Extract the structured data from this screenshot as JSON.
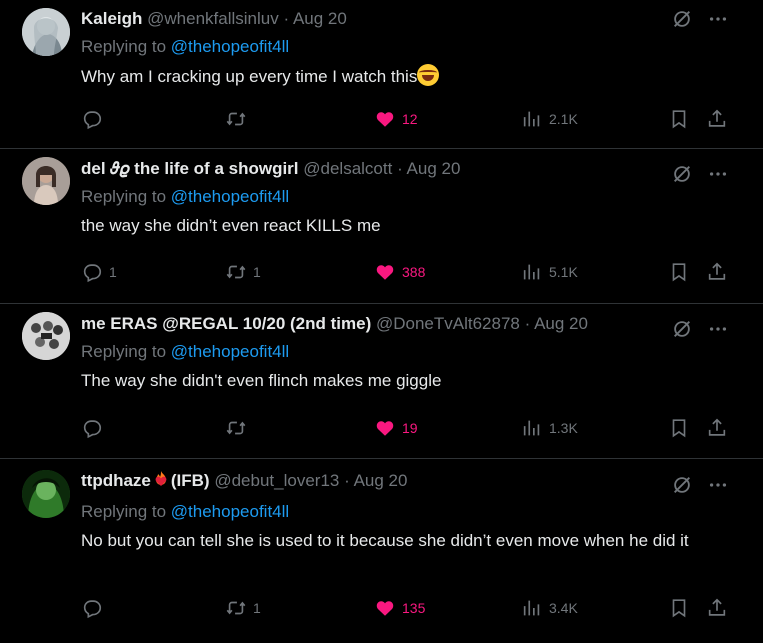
{
  "tweets": [
    {
      "name": "Kaleigh",
      "name_suffix": "",
      "handle": "@whenkfallsinluv",
      "dot": "·",
      "date": "Aug 20",
      "replying_label": "Replying to",
      "replying_to": "@thehopeofit4ll",
      "text": "Why am I cracking up every time I watch this",
      "text_emoji": "tears-of-joy-emoji",
      "replies": "",
      "retweets": "",
      "likes": "12",
      "views": "2.1K",
      "avatar_color": "#b9c2c7"
    },
    {
      "name": "del 𝜗𝜚 the life of a showgirl",
      "name_suffix": "",
      "handle": "@delsalcott",
      "dot": "·",
      "date": "Aug 20",
      "replying_label": "Replying to",
      "replying_to": "@thehopeofit4ll",
      "text": "the way she didn’t even react KILLS me",
      "text_emoji": "",
      "replies": "1",
      "retweets": "1",
      "likes": "388",
      "views": "5.1K",
      "avatar_color": "#8d7d72"
    },
    {
      "name": "me ERAS @REGAL 10/20 (2nd time)",
      "name_suffix": "",
      "handle": "@DoneTvAlt62878",
      "dot": "·",
      "date": "Aug 20",
      "replying_label": "Replying to",
      "replying_to": "@thehopeofit4ll",
      "text": "The way she didn't even flinch makes me giggle",
      "text_emoji": "",
      "replies": "",
      "retweets": "",
      "likes": "19",
      "views": "1.3K",
      "avatar_color": "#cfcfcf"
    },
    {
      "name": "ttpdhaze",
      "name_suffix": "(IFB)",
      "name_emoji": "heart-on-fire-emoji",
      "handle": "@debut_lover13",
      "dot": "·",
      "date": "Aug 20",
      "replying_label": "Replying to",
      "replying_to": "@thehopeofit4ll",
      "text": "No but you can tell she is used to it because she didn’t even move when he did it",
      "text_emoji": "",
      "replies": "",
      "retweets": "1",
      "likes": "135",
      "views": "3.4K",
      "avatar_color": "#1f5a1c"
    }
  ],
  "colors": {
    "accent": "#1d9bf0",
    "like": "#f91880",
    "muted": "#71767b",
    "text": "#e7e9ea",
    "divider": "#2f3336"
  },
  "icons": {
    "grok": "grok-slash-icon",
    "more": "more-icon",
    "reply": "reply-icon",
    "retweet": "retweet-icon",
    "like": "heart-icon",
    "views": "views-icon",
    "bookmark": "bookmark-icon",
    "share": "share-icon"
  }
}
